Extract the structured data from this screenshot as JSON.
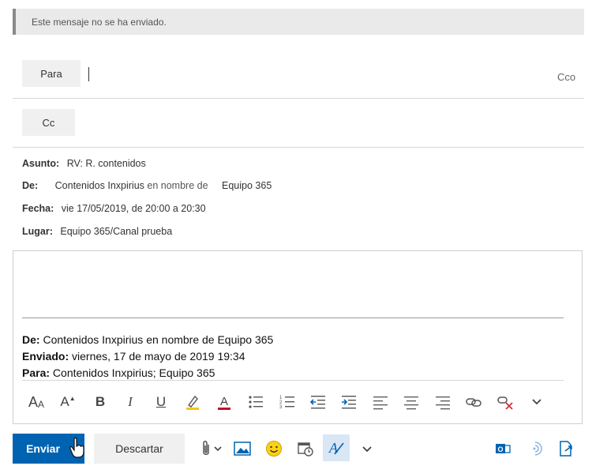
{
  "banner": {
    "text": "Este mensaje no se ha enviado."
  },
  "recipients": {
    "to_label": "Para",
    "cc_label": "Cc",
    "bcc_label": "Cco"
  },
  "meta": {
    "subject_label": "Asunto:",
    "subject_value": "RV: R. contenidos",
    "from_label": "De:",
    "from_name": "Contenidos Inxpirius",
    "from_on_behalf": "en nombre de",
    "from_group": "Equipo 365",
    "date_label": "Fecha:",
    "date_value": "vie 17/05/2019, de 20:00 a 20:30",
    "location_label": "Lugar:",
    "location_value": "Equipo 365/Canal prueba"
  },
  "quoted": {
    "from_label": "De:",
    "from_value": "Contenidos Inxpirius en nombre de Equipo 365",
    "sent_label": "Enviado:",
    "sent_value": "viernes, 17 de mayo de 2019 19:34",
    "to_label": "Para:",
    "to_value": "Contenidos Inxpirius; Equipo 365"
  },
  "format_toolbar": {
    "icons": [
      "font-size-icon",
      "grow-font-icon",
      "bold-icon",
      "italic-icon",
      "underline-icon",
      "highlight-icon",
      "font-color-icon",
      "bullets-icon",
      "numbering-icon",
      "decrease-indent-icon",
      "increase-indent-icon",
      "align-left-icon",
      "align-center-icon",
      "align-right-icon",
      "link-icon",
      "remove-link-icon",
      "more-icon"
    ],
    "bold": "B",
    "italic": "I",
    "underline": "U",
    "font_size": "A",
    "grow_font": "A",
    "highlight": "A",
    "font_color": "A"
  },
  "actions": {
    "send_label": "Enviar",
    "discard_label": "Descartar"
  },
  "colors": {
    "accent": "#0063b1",
    "highlight": "#f2c811",
    "font_color": "#c50f1f",
    "remove": "#d13438"
  }
}
